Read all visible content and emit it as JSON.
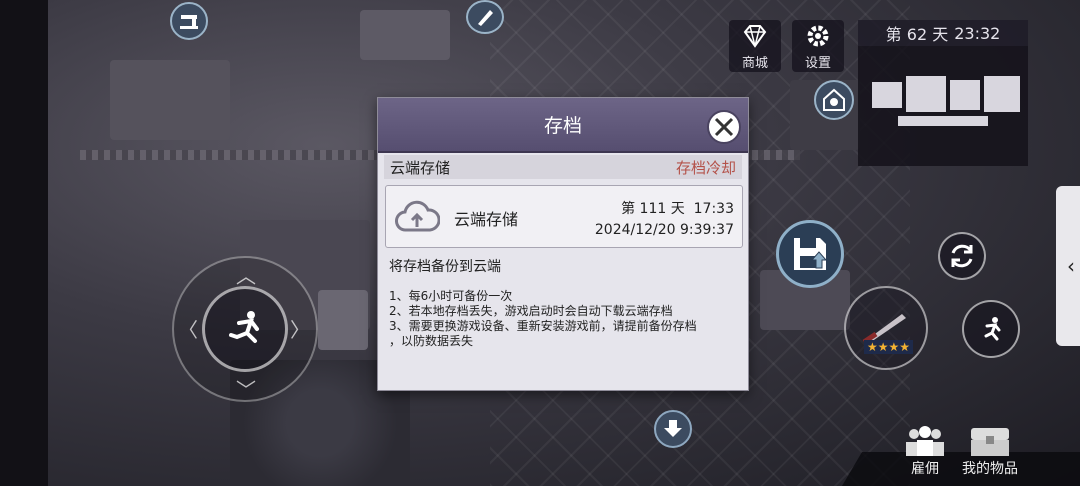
{
  "top": {
    "shop_label": "商城",
    "settings_label": "设置",
    "day_text": "第 62 天",
    "time_text": "23:32"
  },
  "dialog": {
    "title": "存档",
    "section_label": "云端存储",
    "cooldown_text": "存档冷却",
    "save_card": {
      "name": "云端存储",
      "day": "第 111 天",
      "time": "17:33",
      "datetime": "2024/12/20 9:39:37"
    },
    "description": "将存档备份到云端",
    "notes": [
      "1、每6小时可备份一次",
      "2、若本地存档丢失，游戏启动时会自动下载云端存档",
      "3、需要更换游戏设备、重新安装游戏前，请提前备份存档",
      "，以防数据丢失"
    ]
  },
  "weapon": {
    "stars": 4,
    "star_glyph": "★★★★"
  },
  "bottom": {
    "hire_label": "雇佣",
    "items_label": "我的物品"
  },
  "icons": [
    "shop-diamond-icon",
    "settings-gear-icon",
    "cloud-upload-icon",
    "close-icon",
    "save-floppy-icon",
    "refresh-icon",
    "sprint-icon",
    "run-icon",
    "weapon-icon",
    "down-arrow-icon",
    "shelter-icon",
    "sewing-icon",
    "saw-icon",
    "chevron-left-icon",
    "hire-people-icon",
    "chest-icon"
  ]
}
